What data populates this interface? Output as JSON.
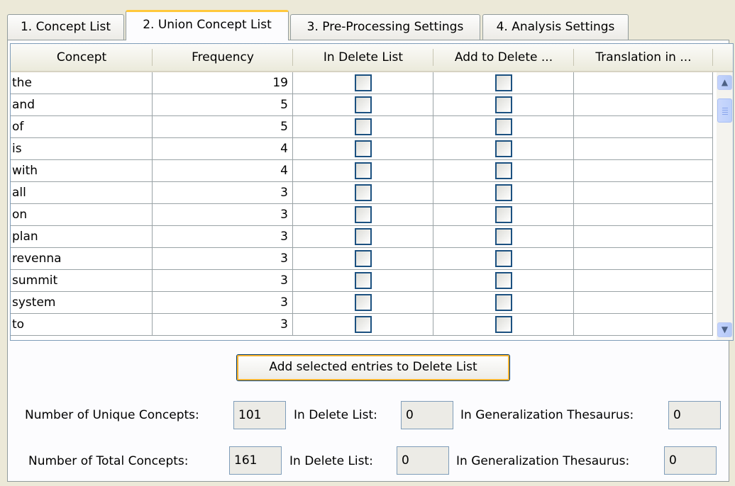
{
  "tabs": [
    {
      "label": "1. Concept List"
    },
    {
      "label": "2. Union Concept List"
    },
    {
      "label": "3. Pre-Processing Settings"
    },
    {
      "label": "4. Analysis Settings"
    }
  ],
  "table": {
    "headers": [
      "Concept",
      "Frequency",
      "In Delete List",
      "Add to Delete ...",
      "Translation in ..."
    ],
    "rows": [
      {
        "concept": "the",
        "frequency": "19",
        "in_delete": false,
        "add_delete": false,
        "translation": ""
      },
      {
        "concept": "and",
        "frequency": "5",
        "in_delete": false,
        "add_delete": false,
        "translation": ""
      },
      {
        "concept": "of",
        "frequency": "5",
        "in_delete": false,
        "add_delete": false,
        "translation": ""
      },
      {
        "concept": "is",
        "frequency": "4",
        "in_delete": false,
        "add_delete": false,
        "translation": ""
      },
      {
        "concept": "with",
        "frequency": "4",
        "in_delete": false,
        "add_delete": false,
        "translation": ""
      },
      {
        "concept": "all",
        "frequency": "3",
        "in_delete": false,
        "add_delete": false,
        "translation": ""
      },
      {
        "concept": "on",
        "frequency": "3",
        "in_delete": false,
        "add_delete": false,
        "translation": ""
      },
      {
        "concept": "plan",
        "frequency": "3",
        "in_delete": false,
        "add_delete": false,
        "translation": ""
      },
      {
        "concept": "revenna",
        "frequency": "3",
        "in_delete": false,
        "add_delete": false,
        "translation": ""
      },
      {
        "concept": "summit",
        "frequency": "3",
        "in_delete": false,
        "add_delete": false,
        "translation": ""
      },
      {
        "concept": "system",
        "frequency": "3",
        "in_delete": false,
        "add_delete": false,
        "translation": ""
      },
      {
        "concept": "to",
        "frequency": "3",
        "in_delete": false,
        "add_delete": false,
        "translation": ""
      }
    ]
  },
  "scrollbar": {
    "up_icon": "chevron-up-icon",
    "down_icon": "chevron-down-icon"
  },
  "add_button_label": "Add selected entries to Delete List",
  "stats": {
    "unique": {
      "label": "Number of Unique Concepts:",
      "value": "101",
      "delete_label": "In Delete List:",
      "delete_value": "0",
      "thesaurus_label": "In Generalization Thesaurus:",
      "thesaurus_value": "0"
    },
    "total": {
      "label": "Number of Total Concepts:",
      "value": "161",
      "delete_label": "In Delete List:",
      "delete_value": "0",
      "thesaurus_label": "In Generalization Thesaurus:",
      "thesaurus_value": "0"
    }
  },
  "colors": {
    "active_tab_accent": "#ffc83c",
    "checkbox_border": "#1c5180",
    "window_bg": "#ece9d8"
  }
}
